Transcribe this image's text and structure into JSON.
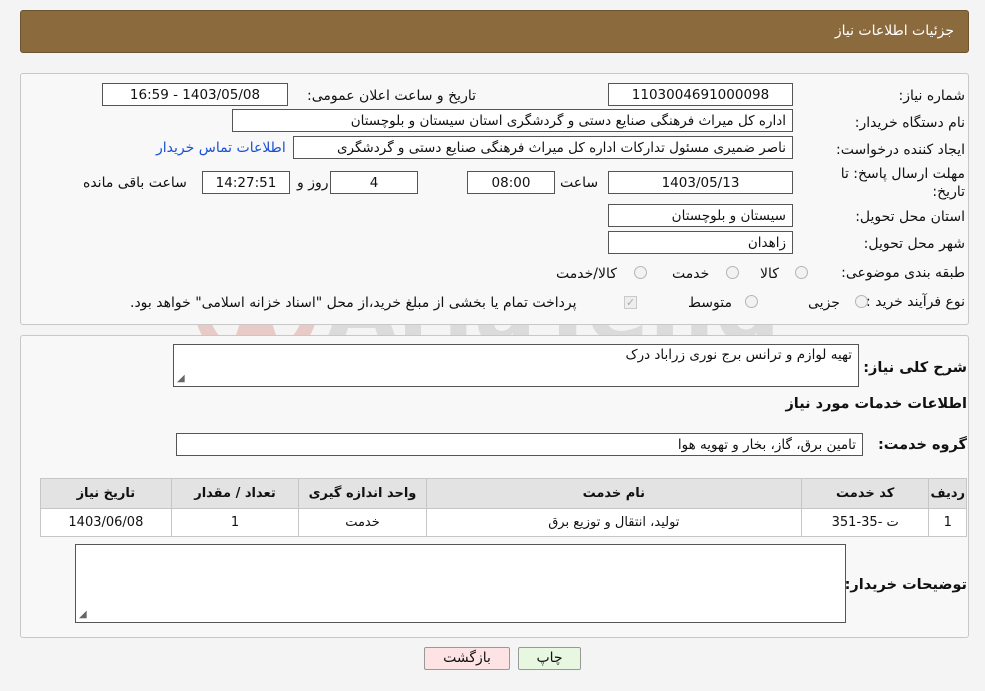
{
  "header": {
    "title": "جزئیات اطلاعات نیاز"
  },
  "form": {
    "need_number": {
      "label": "شماره نیاز:",
      "value": "1103004691000098"
    },
    "announce_datetime": {
      "label": "تاریخ و ساعت اعلان عمومی:",
      "value": "1403/05/08 - 16:59"
    },
    "buyer_org": {
      "label": "نام دستگاه خریدار:",
      "value": "اداره کل میراث فرهنگی  صنایع دستی و گردشگری استان سیستان و بلوچستان"
    },
    "requester": {
      "label": "ایجاد کننده درخواست:",
      "value": "ناصر ضمیری مسئول تدارکات اداره کل میراث فرهنگی  صنایع دستی و گردشگری",
      "contact_link": "اطلاعات تماس خریدار"
    },
    "deadline": {
      "label": "مهلت ارسال پاسخ: تا تاریخ:",
      "date": "1403/05/13",
      "time_label": "ساعت",
      "time": "08:00",
      "days": "4",
      "days_label": "روز و",
      "remaining_time": "14:27:51",
      "remaining_label": "ساعت باقی مانده"
    },
    "province": {
      "label": "استان محل تحویل:",
      "value": "سیستان و بلوچستان"
    },
    "city": {
      "label": "شهر محل تحویل:",
      "value": "زاهدان"
    },
    "category": {
      "label": "طبقه بندی موضوعی:",
      "options": [
        "کالا",
        "خدمت",
        "کالا/خدمت"
      ]
    },
    "purchase_type": {
      "label": "نوع فرآیند خرید :",
      "options": [
        "جزیی",
        "متوسط"
      ],
      "note": "پرداخت تمام یا بخشی از مبلغ خرید،از محل \"اسناد خزانه اسلامی\" خواهد بود."
    }
  },
  "details": {
    "summary_label": "شرح کلی نیاز:",
    "summary_value": "تهیه لوازم و ترانس برج نوری زراباد درک",
    "services_heading": "اطلاعات خدمات مورد نیاز",
    "service_group_label": "گروه خدمت:",
    "service_group_value": "تامین برق، گاز، بخار و تهویه هوا",
    "table": {
      "headers": [
        "ردیف",
        "کد خدمت",
        "نام خدمت",
        "واحد اندازه گیری",
        "تعداد / مقدار",
        "تاریخ نیاز"
      ],
      "rows": [
        [
          "1",
          "ت -35-351",
          "تولید، انتقال و توزیع برق",
          "خدمت",
          "1",
          "1403/06/08"
        ]
      ]
    },
    "buyer_notes_label": "توضیحات خریدار:",
    "buyer_notes_value": ""
  },
  "buttons": {
    "print": "چاپ",
    "back": "بازگشت"
  },
  "colors": {
    "header_bg": "#8b6a3e",
    "link": "#1a4fd6",
    "back_btn_bg": "#fde3e3",
    "print_btn_bg": "#e8f7e0"
  }
}
